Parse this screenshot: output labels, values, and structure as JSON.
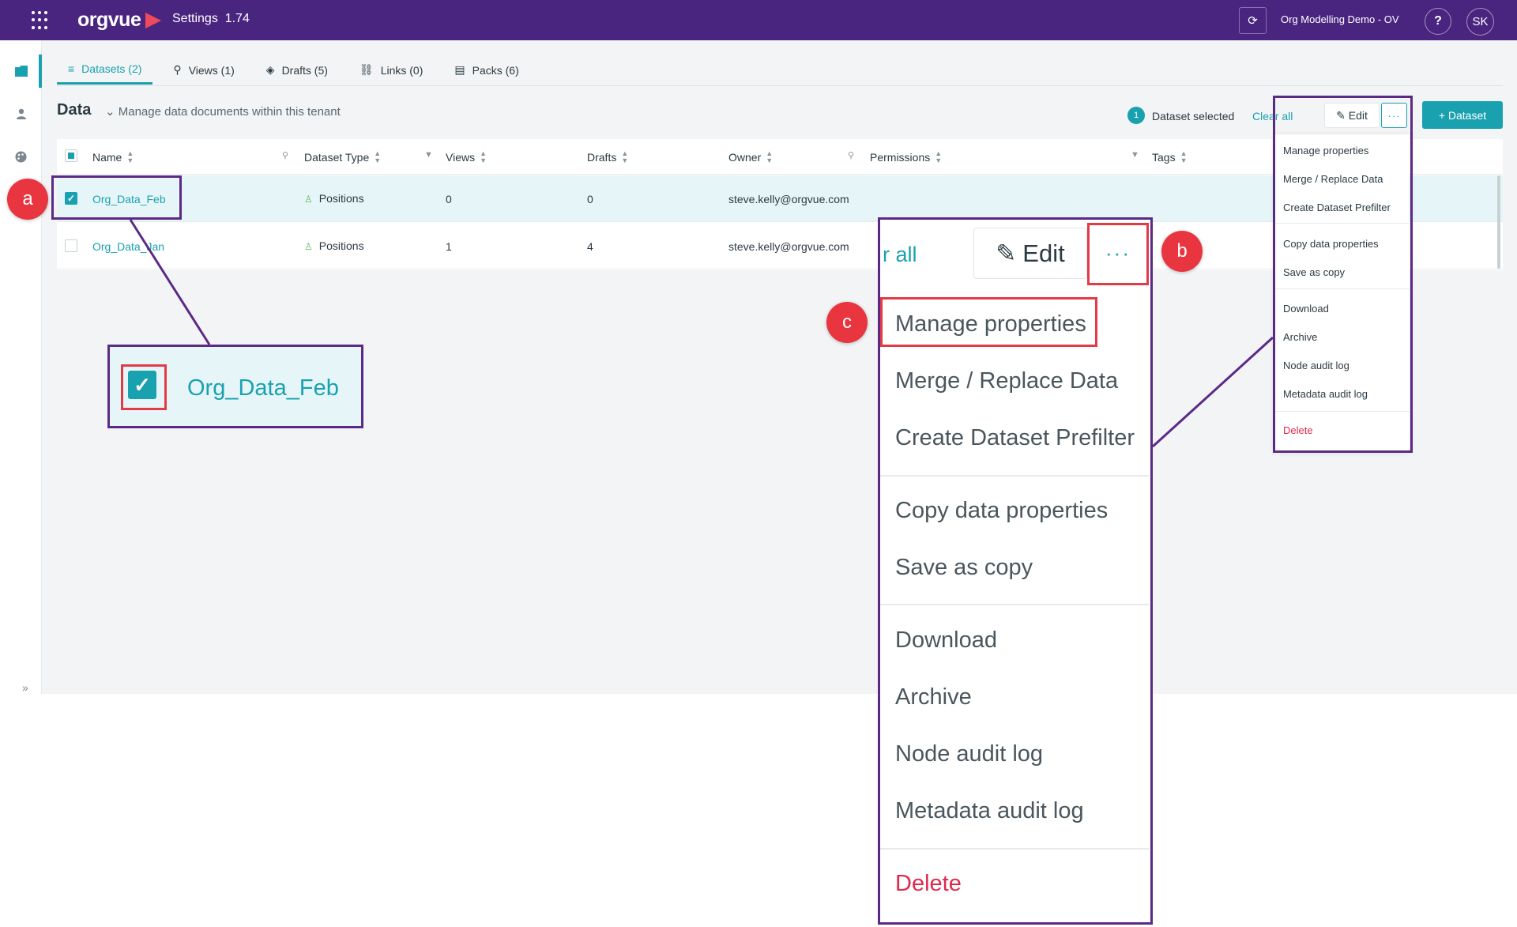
{
  "topbar": {
    "app_name": "orgvue",
    "title": "Settings",
    "version": "1.74",
    "tenant": "Org Modelling Demo - OV",
    "help": "?",
    "avatar": "SK"
  },
  "tabs": [
    {
      "label": "Datasets (2)",
      "icon": "database-icon",
      "active": true
    },
    {
      "label": "Views (1)",
      "icon": "pin-icon",
      "active": false
    },
    {
      "label": "Drafts (5)",
      "icon": "layers-icon",
      "active": false
    },
    {
      "label": "Links (0)",
      "icon": "link-icon",
      "active": false
    },
    {
      "label": "Packs (6)",
      "icon": "pack-icon",
      "active": false
    }
  ],
  "section": {
    "title": "Data",
    "subtitle": "Manage data documents within this tenant"
  },
  "toolbar": {
    "selected_count": "1",
    "selected_text": "Dataset selected",
    "clear_all": "Clear all",
    "edit": "Edit",
    "more": "···",
    "add_dataset": "+ Dataset"
  },
  "table": {
    "columns": [
      "Name",
      "Dataset Type",
      "Views",
      "Drafts",
      "Owner",
      "Permissions",
      "Tags"
    ],
    "rows": [
      {
        "name": "Org_Data_Feb",
        "type": "Positions",
        "views": "0",
        "drafts": "0",
        "owner": "steve.kelly@orgvue.com",
        "checked": true
      },
      {
        "name": "Org_Data_Jan",
        "type": "Positions",
        "views": "1",
        "drafts": "4",
        "owner": "steve.kelly@orgvue.com",
        "checked": false
      }
    ]
  },
  "menu": {
    "items": [
      "Manage properties",
      "Merge / Replace Data",
      "Create Dataset Prefilter",
      "Copy data properties",
      "Save as copy",
      "Download",
      "Archive",
      "Node audit log",
      "Metadata audit log",
      "Delete"
    ]
  },
  "callouts": {
    "a": "a",
    "b": "b",
    "c": "c",
    "zoom_name": "Org_Data_Feb",
    "zoom_clear": "r all",
    "zoom_edit": "Edit",
    "zoom_more": "···"
  },
  "colors": {
    "topbar": "#4a2580",
    "accent": "#1aa1b0",
    "callout_red": "#e8353f",
    "callout_purple": "#5b2a86",
    "delete_red": "#e0284d"
  }
}
